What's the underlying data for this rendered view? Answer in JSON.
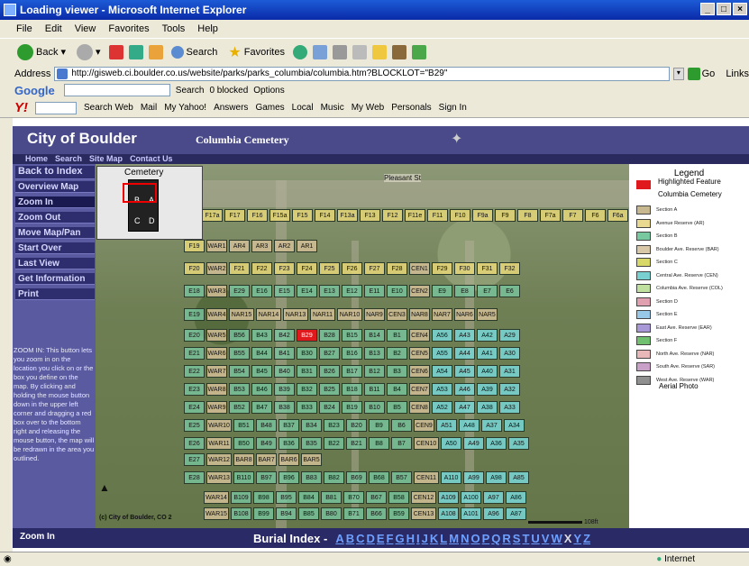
{
  "window": {
    "title": "Loading viewer - Microsoft Internet Explorer"
  },
  "menu": [
    "File",
    "Edit",
    "View",
    "Favorites",
    "Tools",
    "Help"
  ],
  "toolbar": {
    "back": "Back",
    "search": "Search",
    "favorites": "Favorites"
  },
  "address": {
    "label": "Address",
    "url": "http://gisweb.ci.boulder.co.us/website/parks/parks_columbia/columbia.htm?BLOCKLOT=\"B29\"",
    "go": "Go",
    "links": "Links"
  },
  "googlebar": {
    "brand": "Google",
    "search": "Search",
    "blocked": "0 blocked",
    "options": "Options"
  },
  "yahoobar": {
    "search_web": "Search Web",
    "items": [
      "Mail",
      "My Yahoo!",
      "Answers",
      "Games",
      "Local",
      "Music",
      "My Web",
      "Personals",
      "Sign In"
    ]
  },
  "site": {
    "title": "City of Boulder",
    "subtitle": "Columbia Cemetery",
    "nav": [
      "Home",
      "Search",
      "Site Map",
      "Contact Us"
    ],
    "buttons": [
      "Back to Index",
      "Overview Map",
      "Zoom In",
      "Zoom Out",
      "Move Map/Pan",
      "Start Over",
      "Last View",
      "Get Information",
      "Print"
    ],
    "help": "ZOOM IN: This button lets you zoom in on the location you click on or the box you define on the map. By clicking and holding the mouse button down in the upper left corner and dragging a red box over to the bottom right and releasing the mouse button, the map will be redrawn in the area you outlined.",
    "zoom_status": "Zoom In"
  },
  "map": {
    "overview_title": "Cemetery",
    "overview_labels": [
      "B",
      "A",
      "C",
      "D"
    ],
    "street": "Pleasant St",
    "copyright": "(c) City of Boulder, CO 2",
    "scale": "108ft",
    "highlighted": "B29",
    "rows": [
      [
        "F17a",
        "F17",
        "F16",
        "F15a",
        "F15",
        "F14",
        "F13a",
        "F13",
        "F12",
        "F11e",
        "F11",
        "F10",
        "F9a",
        "F9",
        "F8",
        "F7a",
        "F7",
        "F6",
        "F6a"
      ],
      [
        "F19",
        "WAR1",
        "AR4",
        "AR3",
        "AR2",
        "AR1"
      ],
      [
        "F20",
        "WAR2",
        "F21",
        "F22",
        "F23",
        "F24",
        "F25",
        "F26",
        "F27",
        "F28",
        "CEN1",
        "F29",
        "F30",
        "F31",
        "F32"
      ],
      [
        "E18",
        "WAR3",
        "E29",
        "E16",
        "E15",
        "E14",
        "E13",
        "E12",
        "E11",
        "E10",
        "CEN2",
        "E9",
        "E8",
        "E7",
        "E6"
      ],
      [
        "E19",
        "WAR4",
        "NAR15",
        "NAR14",
        "NAR13",
        "NAR11",
        "NAR10",
        "NAR9",
        "CEN3",
        "NAR8",
        "NAR7",
        "NAR6",
        "NAR5"
      ],
      [
        "E20",
        "WAR5",
        "B56",
        "B43",
        "B42",
        "B29",
        "B28",
        "B15",
        "B14",
        "B1",
        "CEN4",
        "A56",
        "A43",
        "A42",
        "A29"
      ],
      [
        "E21",
        "WAR6",
        "B55",
        "B44",
        "B41",
        "B30",
        "B27",
        "B16",
        "B13",
        "B2",
        "CEN5",
        "A55",
        "A44",
        "A41",
        "A30"
      ],
      [
        "E22",
        "WAR7",
        "B54",
        "B45",
        "B40",
        "B31",
        "B26",
        "B17",
        "B12",
        "B3",
        "CEN6",
        "A54",
        "A45",
        "A40",
        "A31"
      ],
      [
        "E23",
        "WAR8",
        "B53",
        "B46",
        "B39",
        "B32",
        "B25",
        "B18",
        "B11",
        "B4",
        "CEN7",
        "A53",
        "A46",
        "A39",
        "A32"
      ],
      [
        "E24",
        "WAR9",
        "B52",
        "B47",
        "B38",
        "B33",
        "B24",
        "B19",
        "B10",
        "B5",
        "CEN8",
        "A52",
        "A47",
        "A38",
        "A33"
      ],
      [
        "E25",
        "WAR10",
        "B51",
        "B48",
        "B37",
        "B34",
        "B23",
        "B20",
        "B9",
        "B6",
        "CEN9",
        "A51",
        "A48",
        "A37",
        "A34"
      ],
      [
        "E26",
        "WAR11",
        "B50",
        "B49",
        "B36",
        "B35",
        "B22",
        "B21",
        "B8",
        "B7",
        "CEN10",
        "A50",
        "A49",
        "A36",
        "A35"
      ],
      [
        "E27",
        "WAR12",
        "BAR8",
        "BAR7",
        "BAR6",
        "BAR5"
      ],
      [
        "E28",
        "WAR13",
        "B110",
        "B97",
        "B96",
        "B83",
        "B82",
        "B69",
        "B68",
        "B57",
        "CEN11",
        "A110",
        "A99",
        "A98",
        "A85"
      ],
      [
        "WAR14",
        "B109",
        "B98",
        "B95",
        "B84",
        "B81",
        "B70",
        "B67",
        "B58",
        "CEN12",
        "A109",
        "A100",
        "A97",
        "A86"
      ],
      [
        "WAR15",
        "B108",
        "B99",
        "B94",
        "B85",
        "B80",
        "B71",
        "B66",
        "B59",
        "CEN13",
        "A108",
        "A101",
        "A96",
        "A87"
      ]
    ]
  },
  "legend": {
    "title": "Legend",
    "highlighted": "Highlighted Feature",
    "cemetery": "Columbia Cemetery",
    "items": [
      "Section A",
      "Avenue Reserve (AR)",
      "Section B",
      "Boulder Ave. Reserve (BAR)",
      "Section C",
      "Central Ave. Reserve (CEN)",
      "Columbia Ave. Reserve (COL)",
      "Section D",
      "Section E",
      "East Ave. Reserve (EAR)",
      "Section F",
      "North Ave. Reserve (NAR)",
      "South Ave. Reserve (SAR)",
      "West Ave. Reserve (WAR)"
    ],
    "colors": [
      "#c8b890",
      "#e8d890",
      "#78c8a0",
      "#d8c8a8",
      "#d8d868",
      "#78d0d0",
      "#c0e0a0",
      "#e0a0b0",
      "#98c8e8",
      "#a898d8",
      "#70c070",
      "#e8b8b8",
      "#c8a0c8",
      "#909090"
    ],
    "highlight_color": "#e0191d",
    "aerial": "Aerial Photo"
  },
  "burial": {
    "label": "Burial Index -",
    "letters": [
      "A",
      "B",
      "C",
      "D",
      "E",
      "F",
      "G",
      "H",
      "I",
      "J",
      "K",
      "L",
      "M",
      "N",
      "O",
      "P",
      "Q",
      "R",
      "S",
      "T",
      "U",
      "V",
      "W",
      "X",
      "Y",
      "Z"
    ],
    "unlinked": [
      "X"
    ]
  },
  "status": {
    "zone": "Internet"
  }
}
